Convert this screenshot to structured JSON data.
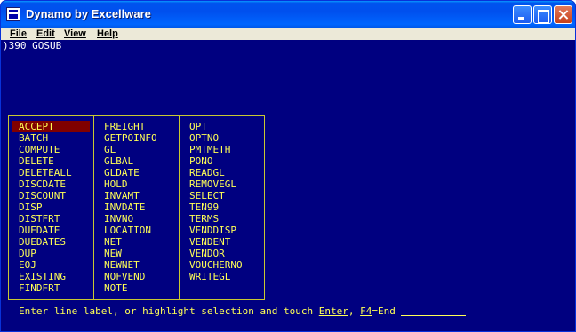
{
  "window": {
    "title": "Dynamo by Excellware"
  },
  "menubar": {
    "file": "File",
    "edit": "Edit",
    "view": "View",
    "help": "Help"
  },
  "console": {
    "prompt": ")390 GOSUB"
  },
  "picker": {
    "selected": "ACCEPT",
    "columns": [
      [
        "ACCEPT",
        "BATCH",
        "COMPUTE",
        "DELETE",
        "DELETEALL",
        "DISCDATE",
        "DISCOUNT",
        "DISP",
        "DISTFRT",
        "DUEDATE",
        "DUEDATES",
        "DUP",
        "EOJ",
        "EXISTING",
        "FINDFRT"
      ],
      [
        "FREIGHT",
        "GETPOINFO",
        "GL",
        "GLBAL",
        "GLDATE",
        "HOLD",
        "INVAMT",
        "INVDATE",
        "INVNO",
        "LOCATION",
        "NET",
        "NEW",
        "NEWNET",
        "NOFVEND",
        "NOTE"
      ],
      [
        "OPT",
        "OPTNO",
        "PMTMETH",
        "PONO",
        "READGL",
        "REMOVEGL",
        "SELECT",
        "TEN99",
        "TERMS",
        "VENDDISP",
        "VENDENT",
        "VENDOR",
        "VOUCHERNO",
        "WRITEGL"
      ]
    ]
  },
  "status": {
    "prefix": "Enter line label, or highlight selection and touch ",
    "enter_key": "Enter",
    "separator": ", ",
    "f4_key": "F4",
    "suffix": "=End"
  }
}
